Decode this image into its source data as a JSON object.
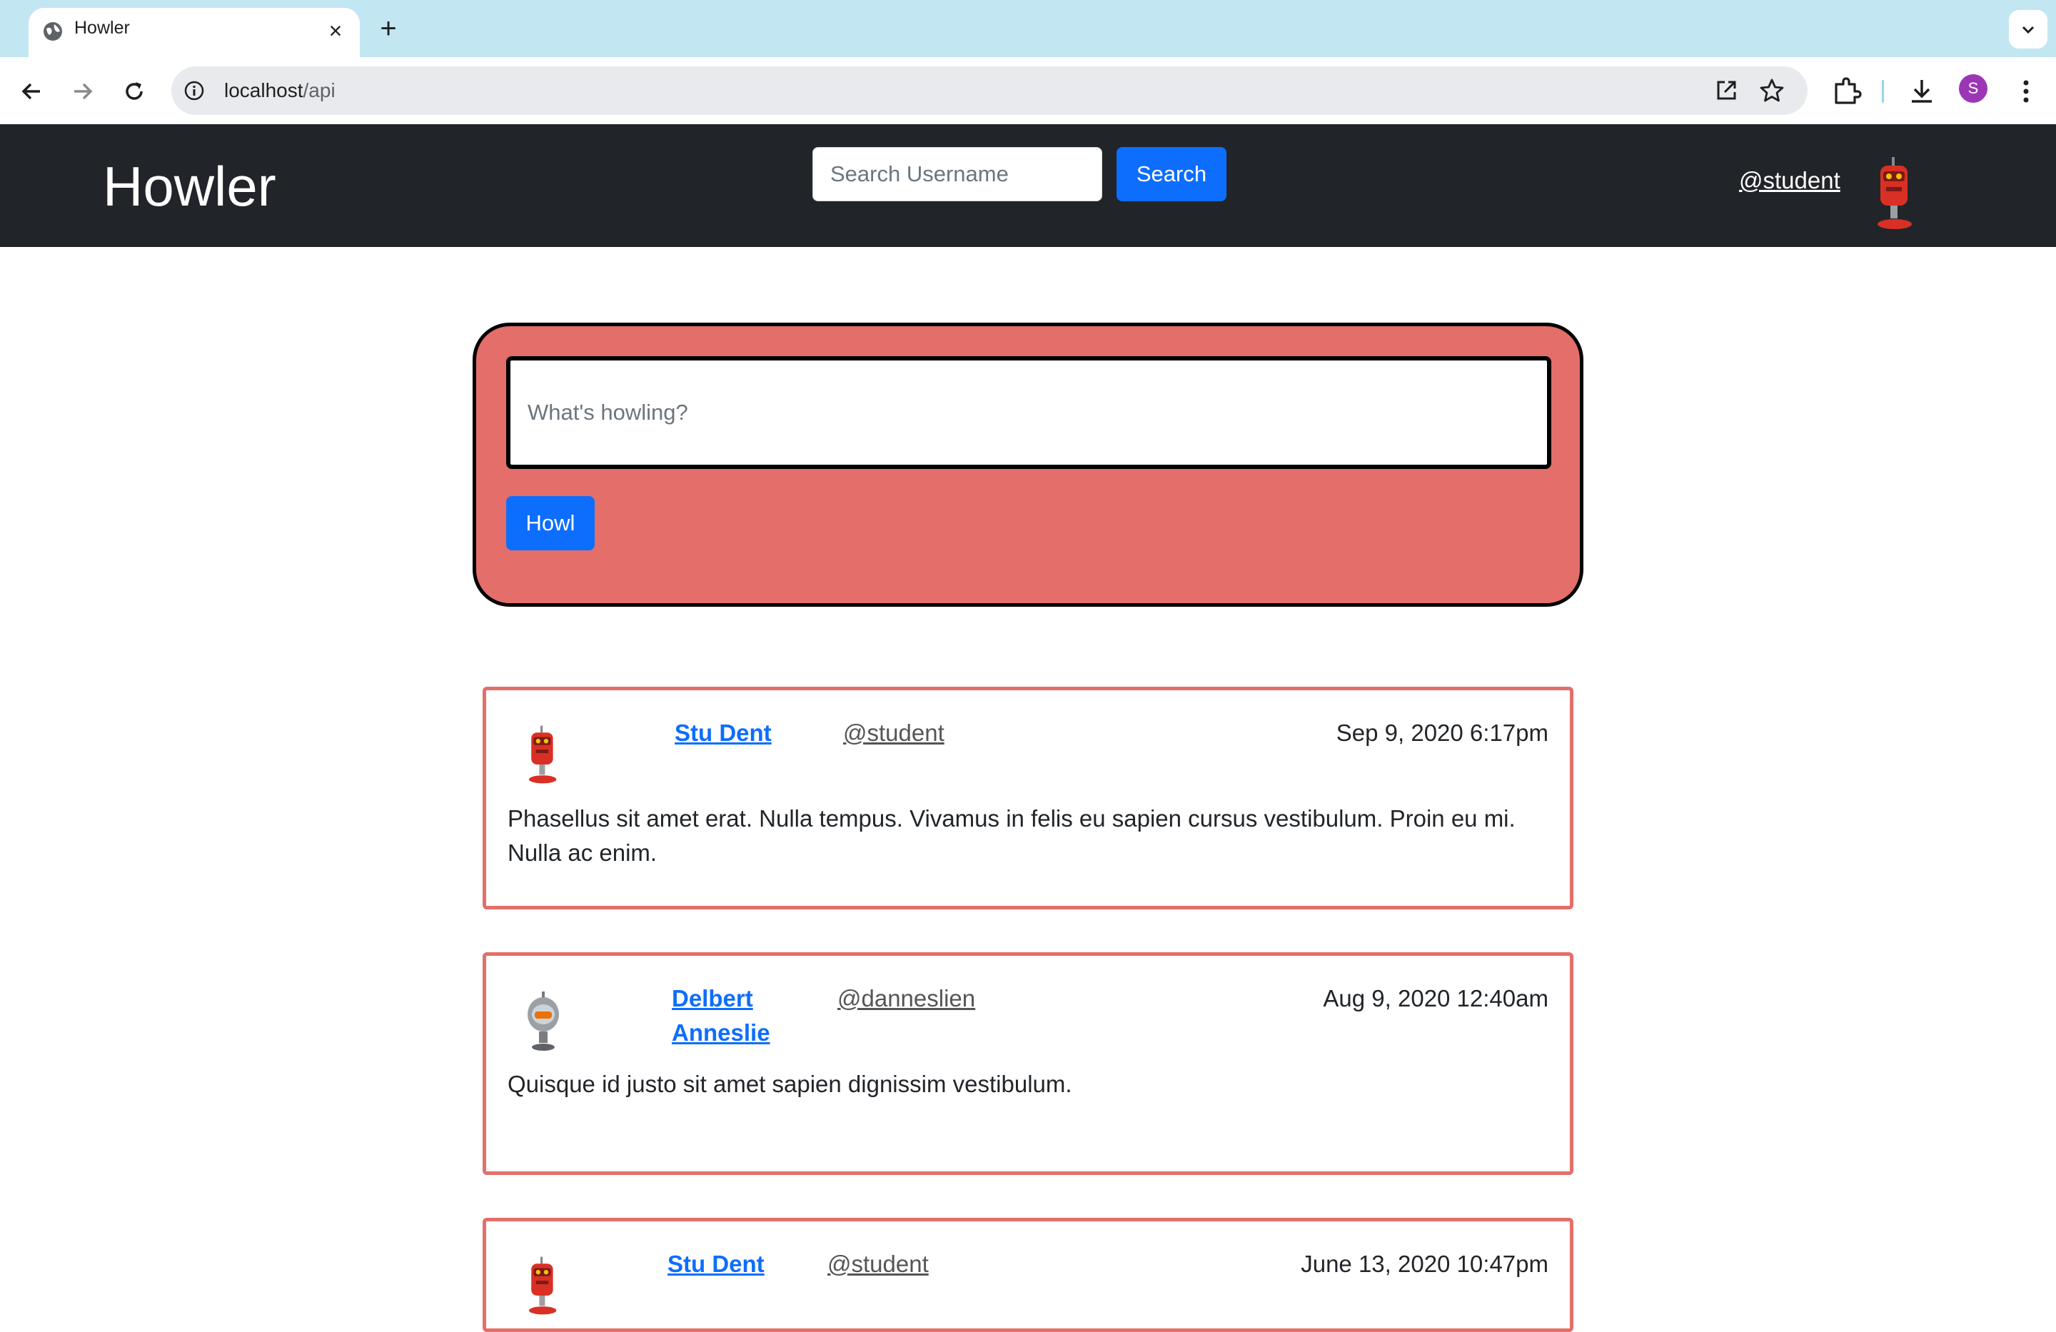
{
  "browser": {
    "tab_title": "Howler",
    "url_host": "localhost",
    "url_path": "/api",
    "profile_initial": "S"
  },
  "header": {
    "brand": "Howler",
    "search_placeholder": "Search Username",
    "search_button": "Search",
    "current_user": "@student"
  },
  "composer": {
    "placeholder": "What's howling?",
    "submit_label": "Howl"
  },
  "feed": [
    {
      "name": "Stu Dent",
      "handle": "@student",
      "date": "Sep 9, 2020 6:17pm",
      "text": "Phasellus sit amet erat. Nulla tempus. Vivamus in felis eu sapien cursus vestibulum. Proin eu mi. Nulla ac enim.",
      "avatar": "red-robot-icon"
    },
    {
      "name": "Delbert Anneslie",
      "handle": "@danneslien",
      "date": "Aug 9, 2020 12:40am",
      "text": "Quisque id justo sit amet sapien dignissim vestibulum.",
      "avatar": "gray-robot-icon"
    },
    {
      "name": "Stu Dent",
      "handle": "@student",
      "date": "June 13, 2020 10:47pm",
      "text": "",
      "avatar": "red-robot-icon"
    }
  ],
  "colors": {
    "navbar": "#212529",
    "primary": "#0d6efd",
    "accent": "#e46e69"
  }
}
